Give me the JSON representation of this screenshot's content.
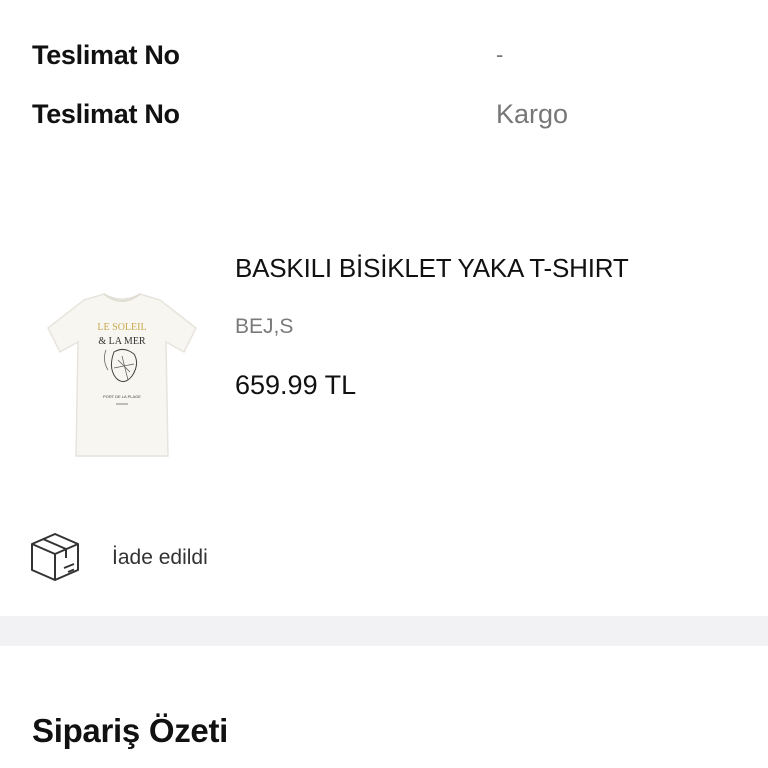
{
  "delivery": {
    "rows": [
      {
        "label": "Teslimat No",
        "value": "-"
      },
      {
        "label": "Teslimat No",
        "value": "Kargo"
      }
    ]
  },
  "product": {
    "name": "BASKILI BİSİKLET YAKA T-SHIRT",
    "variant": "BEJ,S",
    "price": "659.99 TL",
    "image_icon": "tshirt-product-image",
    "print_text_1": "LE SOLEIL",
    "print_text_2": "& LA MER",
    "print_text_3": "PORT DE LA PLAGE"
  },
  "status": {
    "icon": "package-box-icon",
    "text": "İade edildi"
  },
  "summary": {
    "title": "Sipariş Özeti"
  },
  "colors": {
    "divider": "#f2f2f4",
    "muted_text": "#777777",
    "primary_text": "#111111"
  }
}
